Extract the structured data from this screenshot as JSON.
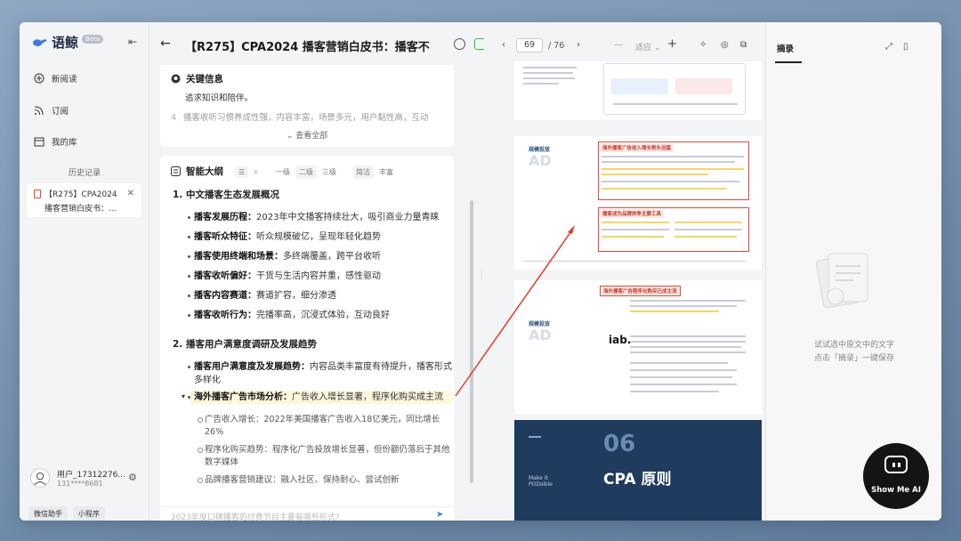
{
  "app": {
    "name": "语鲸",
    "badge": "Beta"
  },
  "sidebar": {
    "nav": [
      {
        "label": "新阅读",
        "icon": "plus-circle-icon"
      },
      {
        "label": "订阅",
        "icon": "rss-icon"
      },
      {
        "label": "我的库",
        "icon": "library-icon"
      }
    ],
    "history_title": "历史记录",
    "history": [
      {
        "line1": "【R275】CPA2024",
        "line2": "播客营销白皮书：..."
      }
    ],
    "user": {
      "name": "用户_17312276...",
      "phone": "131****8681"
    },
    "mini_buttons": [
      "微信助手",
      "小程序"
    ]
  },
  "doc": {
    "title": "【R275】CPA2024 播客营销白皮书：播客不...",
    "key_info": {
      "title": "关键信息",
      "text": "追求知识和陪伴。",
      "next_num": "4",
      "next_text": "播客收听习惯养成性强，内容丰富，场景多元，用户黏性高，互动",
      "view_all": "查看全部"
    },
    "outline": {
      "title": "智能大纲",
      "levels": [
        "一级",
        "二级",
        "三级"
      ],
      "modes": [
        "简洁",
        "丰富"
      ],
      "sections": [
        {
          "num": "1.",
          "title": "中文播客生态发展概况",
          "items": [
            {
              "key": "播客发展历程：",
              "text": "2023年中文播客持续壮大，吸引商业力量青睐"
            },
            {
              "key": "播客听众特征：",
              "text": "听众规模破亿，呈现年轻化趋势"
            },
            {
              "key": "播客使用终端和场景：",
              "text": "多终端覆盖，跨平台收听"
            },
            {
              "key": "播客收听偏好：",
              "text": "干货与生活内容并重，感性驱动"
            },
            {
              "key": "播客内容赛道：",
              "text": "赛道扩容，细分渗透"
            },
            {
              "key": "播客收听行为：",
              "text": "完播率高，沉浸式体验，互动良好"
            }
          ]
        },
        {
          "num": "2.",
          "title": "播客用户满意度调研及发展趋势",
          "items": [
            {
              "key": "播客用户满意度及发展趋势：",
              "text": "内容品类丰富度有待提升，播客形式多样化"
            },
            {
              "key": "海外播客广告市场分析：",
              "text": "广告收入增长显著，程序化购买成主流"
            }
          ],
          "subs": [
            "广告收入增长：2022年美国播客广告收入18亿美元，同比增长26%",
            "程序化购买趋势：程序化广告投放增长显著，但份额仍落后于其他数字媒体",
            "品牌播客营销建议：融入社区、保持耐心、尝试创新"
          ]
        }
      ]
    },
    "input_placeholder": "2023年度口碑播客的付费节目主要有哪些形式?"
  },
  "viewer": {
    "page_current": "69",
    "page_total": "/ 76",
    "zoom_label": "适应",
    "page2": {
      "label": "规模投放",
      "big": "AD",
      "box1_title": "海外播客广告收入增长势头迅猛",
      "box2_title": "播客成为品牌拼争主要工具"
    },
    "page3": {
      "label": "规模投放",
      "big": "AD",
      "box_title": "海外播客广告程序化购买已成主流",
      "iab": "iab."
    },
    "page4": {
      "big_num": "06",
      "heading": "CPA 原则",
      "side_text": "Make it PODsible"
    }
  },
  "excerpt": {
    "title": "摘录",
    "tip_line1": "试试选中原文中的文字",
    "tip_line2": "点击「摘录」一键保存"
  },
  "watermark": {
    "text": "Show Me AI"
  }
}
